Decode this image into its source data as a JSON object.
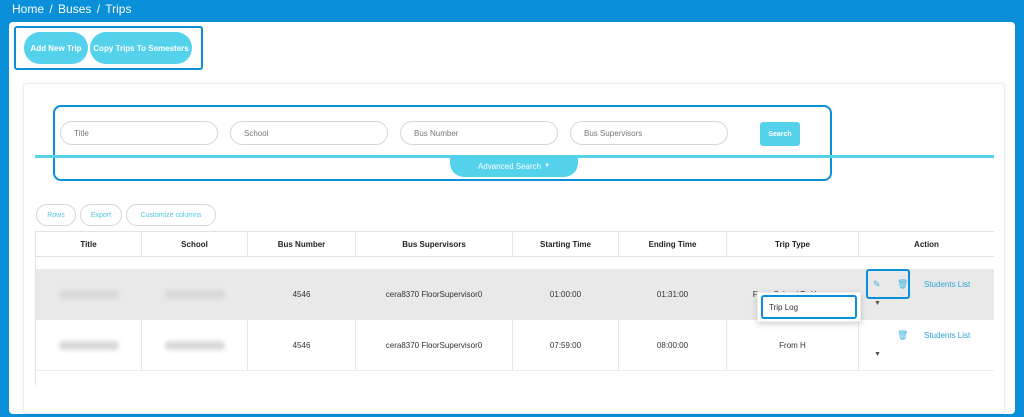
{
  "breadcrumb": [
    "Home",
    "/",
    "Buses",
    "/",
    "Trips"
  ],
  "actions": {
    "add_trip": "Add New Trip",
    "copy_trips": "Copy Trips To Semesters"
  },
  "filters": {
    "title_placeholder": "Title",
    "school_placeholder": "School",
    "bus_number_placeholder": "Bus Number",
    "bus_supervisors_placeholder": "Bus Supervisors",
    "search_label": "Search",
    "advanced_search": "Advanced Search"
  },
  "toolbar": {
    "rows": "Rows",
    "export": "Export",
    "customize": "Customize columns"
  },
  "table": {
    "headers": [
      "Title",
      "School",
      "Bus Number",
      "Bus Supervisors",
      "Starting Time",
      "Ending Time",
      "Trip Type",
      "Action"
    ],
    "rows": [
      {
        "bus_number": "4546",
        "supervisors": "cera8370 FloorSupervisor0",
        "start": "01:00:00",
        "end": "01:31:00",
        "trip_type": "From School To Home",
        "link": "Students List"
      },
      {
        "bus_number": "4546",
        "supervisors": "cera8370 FloorSupervisor0",
        "start": "07:59:00",
        "end": "08:00:00",
        "trip_type": "From H",
        "link": "Students List"
      }
    ]
  },
  "dropdown": {
    "trip_log": "Trip Log"
  },
  "colors": {
    "primary": "#0a8fd9",
    "accent": "#54d2ec"
  },
  "icons": {
    "edit": "pencil-icon",
    "delete": "trash-icon",
    "dropdown": "caret-down-icon"
  }
}
